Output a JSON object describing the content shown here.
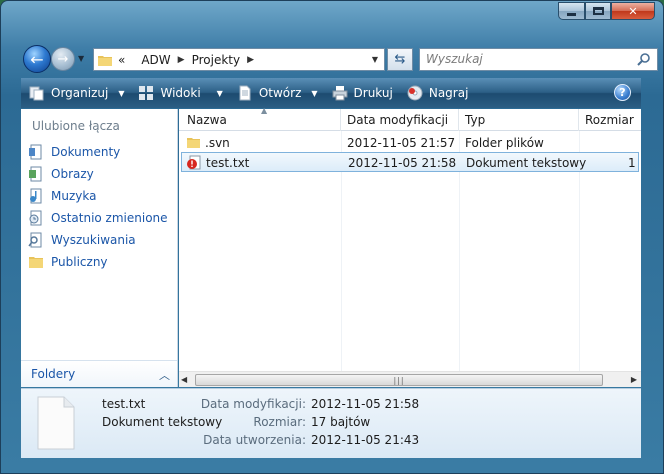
{
  "window": {
    "caption_buttons": [
      "minimize",
      "maximize",
      "close"
    ]
  },
  "nav": {
    "breadcrumb_overflow": "«",
    "breadcrumb": [
      "ADW",
      "Projekty"
    ],
    "search_placeholder": "Wyszukaj"
  },
  "toolbar": {
    "organize": "Organizuj",
    "views": "Widoki",
    "open": "Otwórz",
    "print": "Drukuj",
    "burn": "Nagraj",
    "help": "?"
  },
  "sidebar": {
    "title": "Ulubione łącza",
    "items": [
      {
        "label": "Dokumenty",
        "icon": "documents-icon"
      },
      {
        "label": "Obrazy",
        "icon": "pictures-icon"
      },
      {
        "label": "Muzyka",
        "icon": "music-icon"
      },
      {
        "label": "Ostatnio zmienione",
        "icon": "recent-icon"
      },
      {
        "label": "Wyszukiwania",
        "icon": "searches-icon"
      },
      {
        "label": "Publiczny",
        "icon": "public-folder-icon"
      }
    ],
    "folders_label": "Foldery"
  },
  "filelist": {
    "columns": [
      "Nazwa",
      "Data modyfikacji",
      "Typ",
      "Rozmiar"
    ],
    "rows": [
      {
        "name": ".svn",
        "date": "2012-11-05 21:57",
        "type": "Folder plików",
        "size": "",
        "icon": "folder-icon"
      },
      {
        "name": "test.txt",
        "date": "2012-11-05 21:58",
        "type": "Dokument tekstowy",
        "size": "1 ",
        "icon": "svn-conflict-icon",
        "selected": true
      }
    ]
  },
  "details": {
    "name": "test.txt",
    "kind": "Dokument tekstowy",
    "labels": [
      "Data modyfikacji:",
      "Rozmiar:",
      "Data utworzenia:"
    ],
    "values": [
      "2012-11-05 21:58",
      "17 bajtów",
      "2012-11-05 21:43"
    ]
  },
  "colors": {
    "link_blue": "#1b56a8",
    "selection_border": "#7fb2dc",
    "toolbar_dark": "#1d4b70"
  }
}
